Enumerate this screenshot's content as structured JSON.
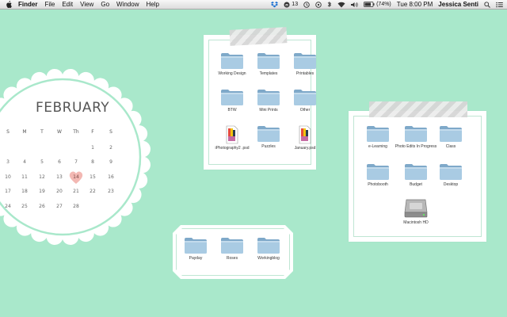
{
  "menubar": {
    "app_name": "Finder",
    "menus": [
      "File",
      "Edit",
      "View",
      "Go",
      "Window",
      "Help"
    ],
    "status": {
      "notification_count": "13",
      "battery": "(74%)",
      "clock": "Tue 8:00 PM",
      "user": "Jessica Senti"
    }
  },
  "calendar": {
    "month": "FEBRUARY",
    "weekdays": [
      "S",
      "M",
      "T",
      "W",
      "Th",
      "F",
      "S"
    ],
    "days": [
      "1",
      "2",
      "3",
      "4",
      "5",
      "6",
      "7",
      "8",
      "9",
      "10",
      "11",
      "12",
      "13",
      "14",
      "15",
      "16",
      "17",
      "18",
      "19",
      "20",
      "21",
      "22",
      "23",
      "24",
      "25",
      "26",
      "27",
      "28"
    ],
    "highlighted_day": "14",
    "accent_color": "#a9e8cb",
    "highlight_color": "#f3b8b3"
  },
  "frame_center": {
    "items": [
      {
        "label": "Working Design",
        "icon": "folder-icon"
      },
      {
        "label": "Templates",
        "icon": "folder-icon"
      },
      {
        "label": "Printables",
        "icon": "folder-icon"
      },
      {
        "label": "BTW",
        "icon": "folder-icon"
      },
      {
        "label": "Mini Prints",
        "icon": "folder-icon"
      },
      {
        "label": "Other",
        "icon": "folder-icon"
      },
      {
        "label": "iPhotography2 .psd",
        "icon": "psd-file-icon"
      },
      {
        "label": "Puzzles",
        "icon": "folder-icon"
      },
      {
        "label": "January.psd",
        "icon": "psd-file-icon"
      }
    ]
  },
  "frame_right": {
    "items": [
      {
        "label": "e-Learning",
        "icon": "folder-icon"
      },
      {
        "label": "Photo Edits In Progress",
        "icon": "folder-icon"
      },
      {
        "label": "Class",
        "icon": "folder-icon"
      },
      {
        "label": "Photobooth",
        "icon": "folder-icon"
      },
      {
        "label": "Budget",
        "icon": "folder-icon"
      },
      {
        "label": "Desktop",
        "icon": "folder-icon"
      },
      {
        "label": "Macintosh HD",
        "icon": "hard-drive-icon"
      }
    ]
  },
  "frame_bottom": {
    "items": [
      {
        "label": "Payday",
        "icon": "folder-icon"
      },
      {
        "label": "Roses",
        "icon": "folder-icon"
      },
      {
        "label": "Workingblog",
        "icon": "folder-icon"
      }
    ]
  },
  "colors": {
    "desktop_bg": "#a9e8cb",
    "folder_light": "#a9cbe3",
    "folder_dark": "#7fa9c9"
  }
}
